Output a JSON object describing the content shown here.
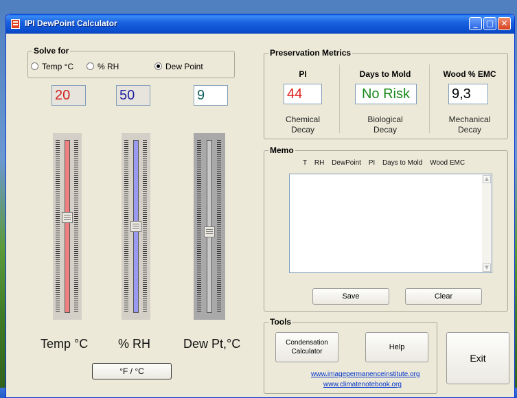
{
  "window": {
    "title": "IPI DewPoint Calculator"
  },
  "solve_for": {
    "label": "Solve for",
    "options": [
      {
        "label": "Temp °C",
        "selected": false
      },
      {
        "label": "% RH",
        "selected": false
      },
      {
        "label": "Dew Point",
        "selected": true
      }
    ]
  },
  "values": {
    "temp": "20",
    "rh": "50",
    "dew_point": "9"
  },
  "sliders": [
    {
      "label": "Temp °C",
      "level": 0.55,
      "color": "#f08080"
    },
    {
      "label": "% RH",
      "level": 0.5,
      "color": "#9a9af0"
    },
    {
      "label": "Dew Pt,°C",
      "level": 0.47,
      "color": "#c8c8c8"
    }
  ],
  "unit_toggle": "°F / °C",
  "preservation": {
    "label": "Preservation Metrics",
    "pi": {
      "heading": "PI",
      "value": "44",
      "sub1": "Chemical",
      "sub2": "Decay",
      "color": "#e02020"
    },
    "mold": {
      "heading": "Days to Mold",
      "value": "No Risk",
      "sub1": "Biological",
      "sub2": "Decay",
      "color": "#1a8a1a"
    },
    "emc": {
      "heading": "Wood % EMC",
      "value": "9,3",
      "sub1": "Mechanical",
      "sub2": "Decay",
      "color": "#000000"
    }
  },
  "memo": {
    "label": "Memo",
    "columns": [
      "T",
      "RH",
      "DewPoint",
      "PI",
      "Days to Mold",
      "Wood EMC"
    ],
    "save": "Save",
    "clear": "Clear"
  },
  "tools": {
    "label": "Tools",
    "condensation": "Condensation Calculator",
    "help": "Help",
    "links": [
      "www.imagepermanenceinstitute.org",
      "www.climatenotebook.org"
    ]
  },
  "exit": "Exit"
}
